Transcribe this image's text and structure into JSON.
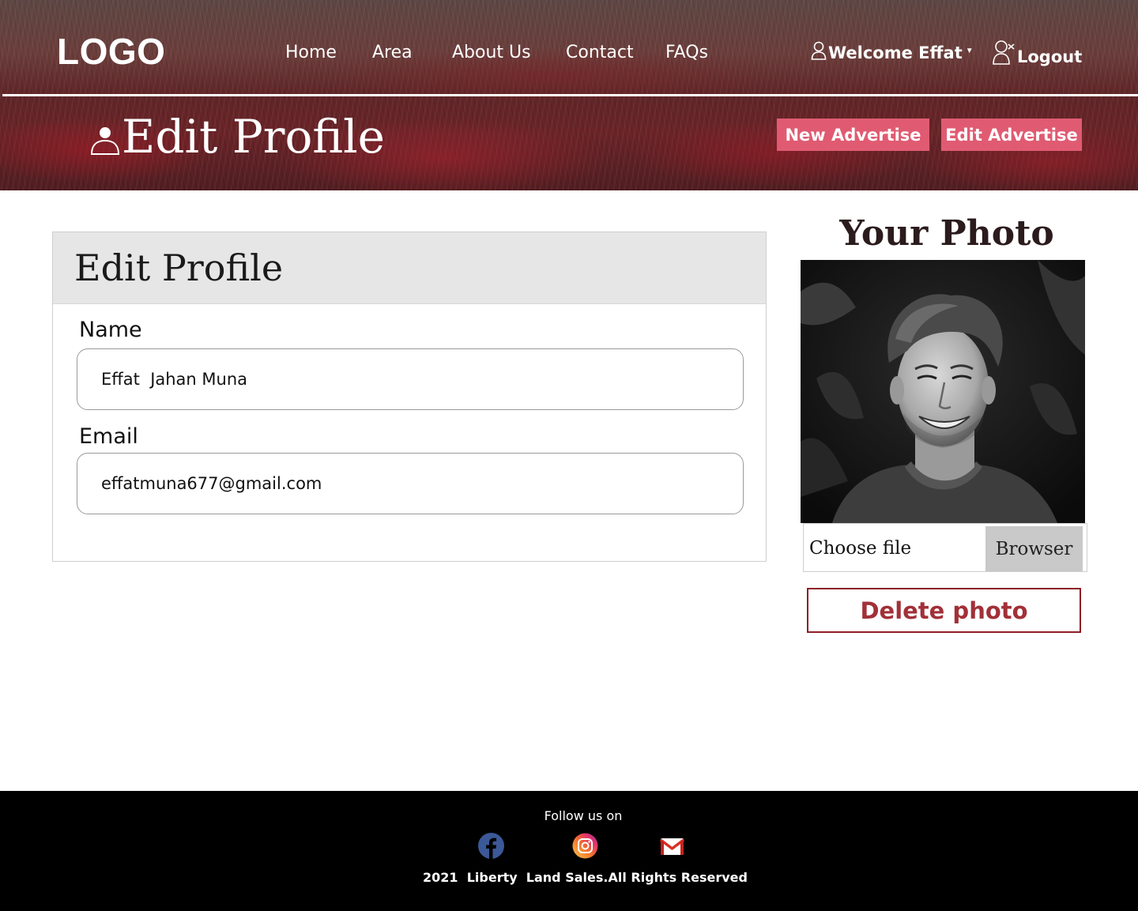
{
  "header": {
    "logo": "LOGO",
    "nav": [
      "Home",
      "Area",
      "About Us",
      "Contact",
      "FAQs"
    ],
    "welcome": "Welcome Effat",
    "logout": "Logout"
  },
  "banner": {
    "title": "Edit Profile",
    "new_advertise": "New Advertise",
    "edit_advertise": "Edit Advertise"
  },
  "form": {
    "title": "Edit Profile",
    "name_label": "Name",
    "name_value": "Effat  Jahan Muna",
    "email_label": "Email",
    "email_value": "effatmuna677@gmail.com"
  },
  "photo": {
    "title": "Your Photo",
    "choose_file": "Choose file",
    "browse": "Browser",
    "delete": "Delete photo"
  },
  "footer": {
    "follow": "Follow us on",
    "social": [
      "facebook-icon",
      "instagram-icon",
      "gmail-icon"
    ],
    "copyright": "2021  Liberty  Land Sales.All Rights Reserved"
  },
  "colors": {
    "accent_pink": "#e05b72",
    "delete_red": "#a23038",
    "footer_bg": "#000000"
  }
}
